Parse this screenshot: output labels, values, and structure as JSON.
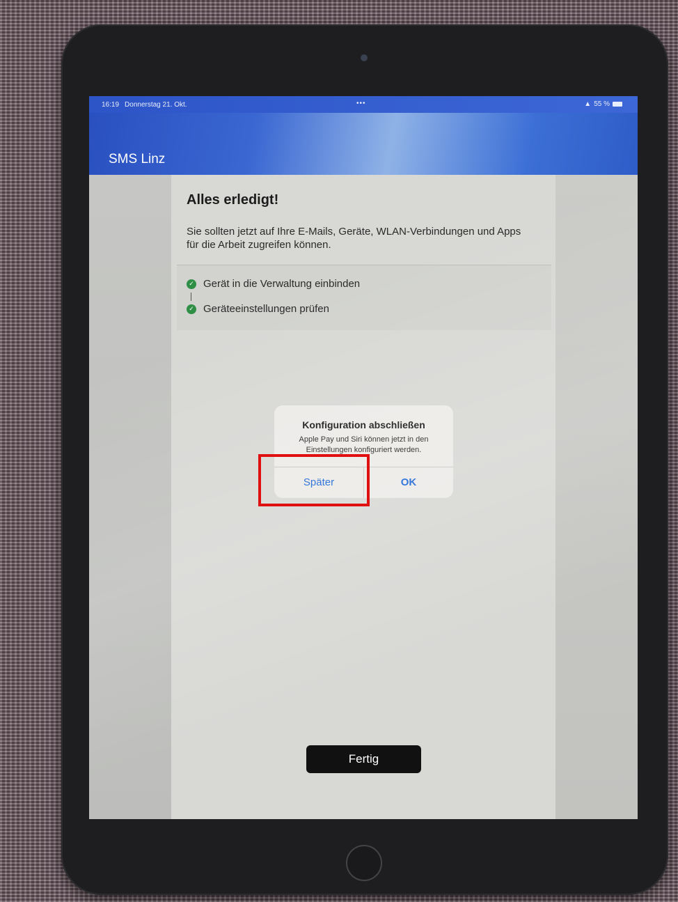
{
  "status_bar": {
    "time": "16:19",
    "date": "Donnerstag 21. Okt.",
    "multitask_dots": "•••",
    "battery": "55 %"
  },
  "header": {
    "title": "SMS Linz"
  },
  "main": {
    "title": "Alles erledigt!",
    "description": "Sie sollten jetzt auf Ihre E-Mails, Geräte, WLAN-Verbindungen und Apps für die Arbeit zugreifen können.",
    "steps": [
      {
        "label": "Gerät in die Verwaltung einbinden",
        "status": "done"
      },
      {
        "label": "Geräteeinstellungen prüfen",
        "status": "done"
      }
    ],
    "done_button": "Fertig"
  },
  "dialog": {
    "title": "Konfiguration abschließen",
    "message": "Apple Pay und Siri können jetzt in den Einstellungen konfiguriert werden.",
    "later_button": "Später",
    "ok_button": "OK"
  },
  "colors": {
    "header_blue": "#2d55c8",
    "dialog_button_blue": "#1e66d6",
    "check_green": "#2f8f46",
    "highlight_red": "#e01010"
  }
}
